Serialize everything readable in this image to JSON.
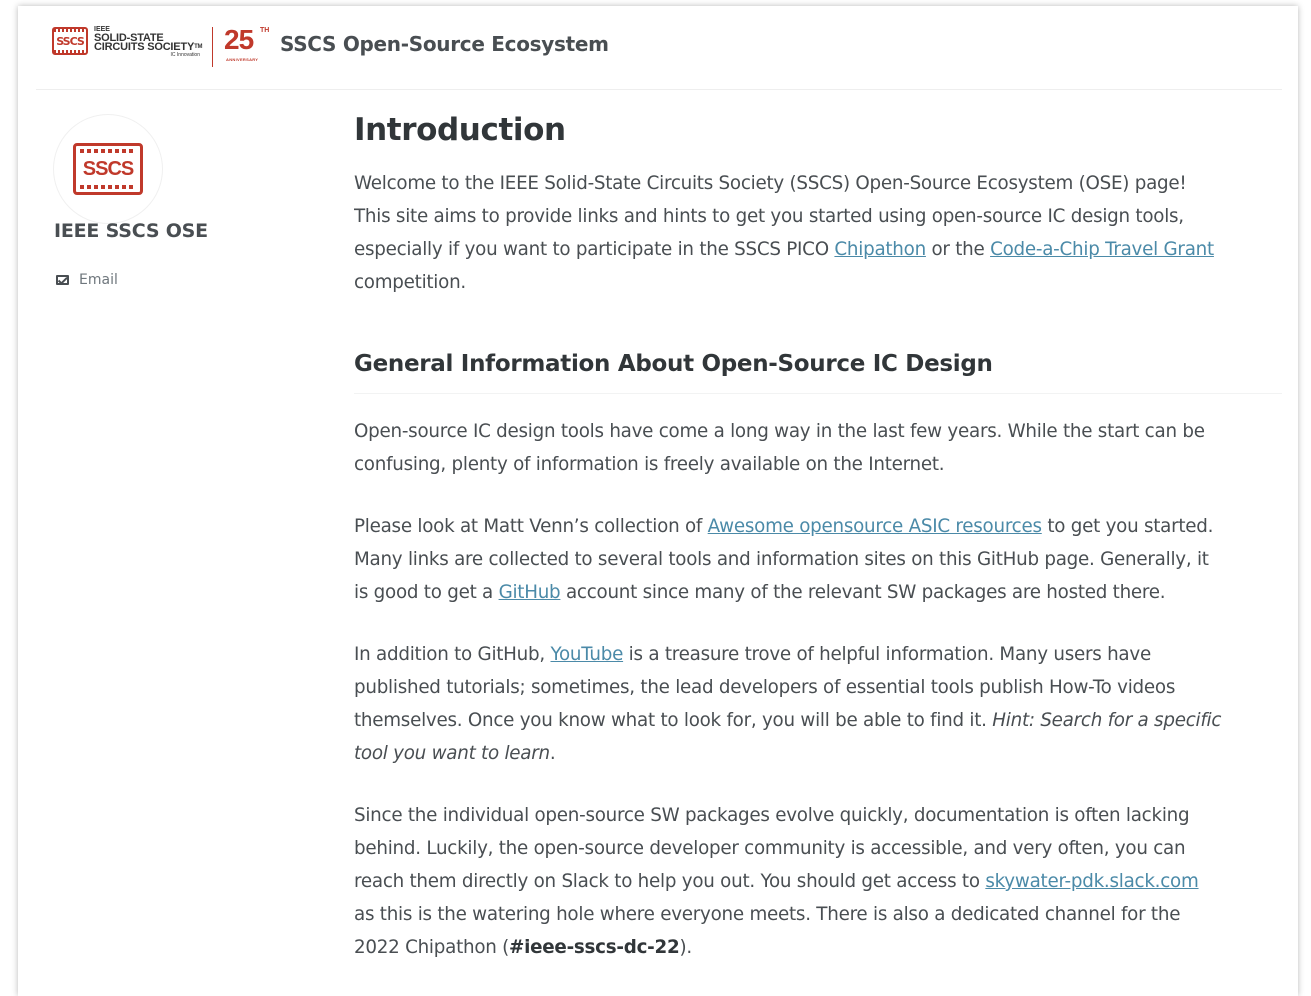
{
  "header": {
    "badge_text": "SSCS",
    "society_line0": "IEEE",
    "society_line1": "SOLID-STATE",
    "society_line2": "CIRCUITS SOCIETY",
    "society_tm": "TM",
    "society_line3": "IC Innovation",
    "anniversary_number": "25",
    "anniversary_suffix": "TH",
    "anniversary_label": "ANNIVERSARY",
    "site_title": "SSCS Open-Source Ecosystem"
  },
  "sidebar": {
    "avatar_text": "SSCS",
    "author_name": "IEEE SSCS OSE",
    "email_label": "Email"
  },
  "main": {
    "page_title": "Introduction",
    "intro": {
      "line1": "Welcome to the IEEE Solid-State Circuits Society (SSCS) Open-Source Ecosystem (OSE) page!",
      "line2": "This site aims to provide links and hints to get you started using open-source IC design tools,",
      "line3_pre": "especially if you want to participate in the SSCS PICO ",
      "link_chipathon": "Chipathon",
      "line3_mid": " or the ",
      "link_code_a_chip": "Code-a-Chip Travel Grant",
      "line4": "competition."
    },
    "section_title": "General Information About Open-Source IC Design",
    "p1": {
      "line1": "Open-source IC design tools have come a long way in the last few years. While the start can be",
      "line2": "confusing, plenty of information is freely available on the Internet."
    },
    "p2": {
      "line1_pre": "Please look at Matt Venn’s collection of ",
      "link_awesome": "Awesome opensource ASIC resources",
      "line1_post": " to get you started.",
      "line2": "Many links are collected to several tools and information sites on this GitHub page. Generally, it",
      "line3_pre": "is good to get a ",
      "link_github": "GitHub",
      "line3_post": " account since many of the relevant SW packages are hosted there."
    },
    "p3": {
      "line1_pre": "In addition to GitHub, ",
      "link_youtube": "YouTube",
      "line1_post": " is a treasure trove of helpful information. Many users have",
      "line2": "published tutorials; sometimes, the lead developers of essential tools publish How-To videos",
      "line3_pre": "themselves. Once you know what to look for, you will be able to find it. ",
      "line3_hint": "Hint: Search for a specific",
      "line4_hint": "tool you want to learn",
      "line4_post": "."
    },
    "p4": {
      "line1": "Since the individual open-source SW packages evolve quickly, documentation is often lacking",
      "line2": "behind. Luckily, the open-source developer community is accessible, and very often, you can",
      "line3_pre": "reach them directly on Slack to help you out. You should get access to ",
      "link_slack": "skywater-pdk.slack.com",
      "line4": "as this is the watering hole where everyone meets. There is also a dedicated channel for the",
      "line5_pre": "2022 Chipathon (",
      "line5_channel": "#ieee-sscs-dc-22",
      "line5_post": ")."
    }
  }
}
